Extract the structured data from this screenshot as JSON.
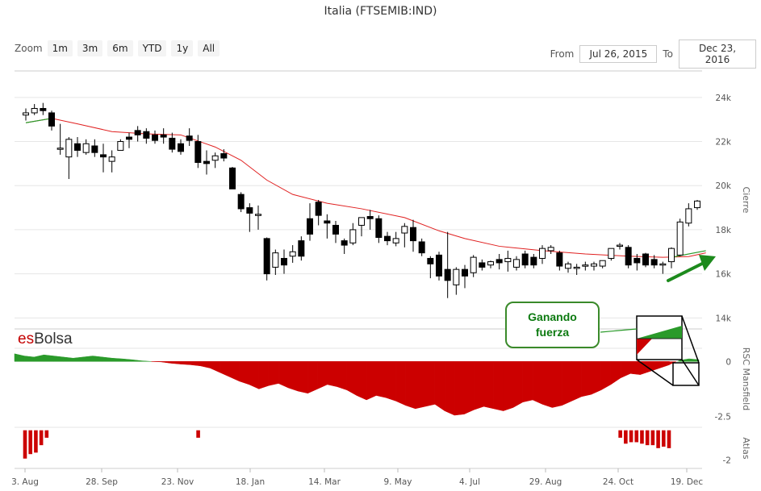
{
  "title": "Italia (FTSEMIB:IND)",
  "zoom": {
    "label": "Zoom",
    "buttons": [
      "1m",
      "3m",
      "6m",
      "YTD",
      "1y",
      "All"
    ]
  },
  "range": {
    "from_label": "From",
    "from_value": "Jul 26, 2015",
    "to_label": "To",
    "to_value": "Dec 23, 2016"
  },
  "brand": {
    "es": "es",
    "name": "Bolsa"
  },
  "callout": {
    "line1": "Ganando",
    "line2": "fuerza"
  },
  "colors": {
    "up_fill": "#ffffff",
    "down_fill": "#000000",
    "ma_line": "#e02020",
    "positive": "#2a9a2a",
    "negative": "#cc0000",
    "arrow": "#1c8a1c",
    "grid": "#e6e6e6"
  },
  "chart_data": [
    {
      "type": "candlestick",
      "title": "Italia (FTSEMIB:IND)",
      "ylabel": "Cierre",
      "ylim": [
        13500,
        25200
      ],
      "yticks": [
        14000,
        16000,
        18000,
        20000,
        22000,
        24000
      ],
      "ytick_labels": [
        "14k",
        "16k",
        "18k",
        "20k",
        "22k",
        "24k"
      ],
      "xticks": [
        "3. Aug",
        "28. Sep",
        "23. Nov",
        "18. Jan",
        "14. Mar",
        "9. May",
        "4. Jul",
        "29. Aug",
        "24. Oct",
        "19. Dec"
      ],
      "candles": [
        [
          23200,
          23500,
          22950,
          23300
        ],
        [
          23300,
          23700,
          23200,
          23500
        ],
        [
          23500,
          23750,
          23200,
          23400
        ],
        [
          23300,
          23400,
          22500,
          22700
        ],
        [
          21700,
          22800,
          21400,
          21700
        ],
        [
          21300,
          22200,
          20300,
          22100
        ],
        [
          21900,
          22200,
          21300,
          21600
        ],
        [
          21500,
          22100,
          21400,
          21900
        ],
        [
          21800,
          22100,
          21300,
          21500
        ],
        [
          21400,
          21900,
          20600,
          21300
        ],
        [
          21100,
          21600,
          20600,
          21300
        ],
        [
          21600,
          22100,
          21600,
          22000
        ],
        [
          22200,
          22400,
          21700,
          22100
        ],
        [
          22500,
          22700,
          22000,
          22300
        ],
        [
          22450,
          22600,
          21900,
          22150
        ],
        [
          22300,
          22500,
          21900,
          22050
        ],
        [
          22300,
          22600,
          21900,
          22200
        ],
        [
          22150,
          22400,
          21500,
          21650
        ],
        [
          21900,
          22100,
          21400,
          21550
        ],
        [
          22250,
          22600,
          21800,
          22050
        ],
        [
          22000,
          22300,
          20800,
          21050
        ],
        [
          21100,
          21600,
          20500,
          21000
        ],
        [
          21150,
          21500,
          20800,
          21350
        ],
        [
          21450,
          21650,
          21100,
          21250
        ],
        [
          20800,
          20850,
          19850,
          19850
        ],
        [
          19600,
          19700,
          18800,
          18950
        ],
        [
          19000,
          19200,
          17900,
          18750
        ],
        [
          18650,
          19100,
          18000,
          18700
        ],
        [
          17600,
          17650,
          15700,
          16000
        ],
        [
          16300,
          17100,
          15950,
          16950
        ],
        [
          16700,
          17100,
          16000,
          16400
        ],
        [
          16800,
          17300,
          16500,
          17000
        ],
        [
          17500,
          17700,
          16600,
          16800
        ],
        [
          18500,
          19200,
          17500,
          17800
        ],
        [
          19250,
          19350,
          18200,
          18650
        ],
        [
          18400,
          18700,
          17600,
          18300
        ],
        [
          18200,
          18400,
          17400,
          17800
        ],
        [
          17500,
          17600,
          16900,
          17300
        ],
        [
          17400,
          18300,
          17300,
          18000
        ],
        [
          18200,
          18500,
          17700,
          18550
        ],
        [
          18600,
          18900,
          18000,
          18500
        ],
        [
          18500,
          18650,
          17400,
          17650
        ],
        [
          17700,
          17900,
          17300,
          17500
        ],
        [
          17400,
          17900,
          17250,
          17600
        ],
        [
          17850,
          18300,
          17200,
          18150
        ],
        [
          18100,
          18450,
          17000,
          17500
        ],
        [
          17450,
          17600,
          16800,
          16950
        ],
        [
          16700,
          16800,
          15800,
          16450
        ],
        [
          16850,
          17000,
          15700,
          15900
        ],
        [
          16200,
          17900,
          14900,
          15700
        ],
        [
          15500,
          16300,
          15050,
          16200
        ],
        [
          16200,
          16400,
          15350,
          15900
        ],
        [
          16050,
          16850,
          15850,
          16750
        ],
        [
          16500,
          16650,
          16150,
          16300
        ],
        [
          16400,
          16600,
          16250,
          16550
        ],
        [
          16650,
          16900,
          16200,
          16500
        ],
        [
          16550,
          17050,
          16100,
          16700
        ],
        [
          16300,
          16800,
          16150,
          16650
        ],
        [
          16900,
          17050,
          16250,
          16400
        ],
        [
          16750,
          16900,
          16250,
          16400
        ],
        [
          16700,
          17300,
          16450,
          17150
        ],
        [
          17050,
          17300,
          16900,
          17200
        ],
        [
          16950,
          17050,
          16150,
          16350
        ],
        [
          16250,
          16550,
          16050,
          16450
        ],
        [
          16250,
          16450,
          15950,
          16300
        ],
        [
          16350,
          16550,
          16150,
          16400
        ],
        [
          16350,
          16550,
          16150,
          16450
        ],
        [
          16350,
          16600,
          16250,
          16600
        ],
        [
          16700,
          17150,
          16600,
          17150
        ],
        [
          17250,
          17400,
          17100,
          17300
        ],
        [
          17200,
          17300,
          16250,
          16400
        ],
        [
          16700,
          16900,
          16150,
          16500
        ],
        [
          16900,
          16950,
          16300,
          16400
        ],
        [
          16650,
          16850,
          16250,
          16400
        ],
        [
          16400,
          16550,
          16000,
          16450
        ],
        [
          16550,
          17200,
          16250,
          17150
        ],
        [
          16850,
          18500,
          16800,
          18350
        ],
        [
          18300,
          19200,
          18150,
          18950
        ],
        [
          19000,
          19350,
          18900,
          19300
        ]
      ],
      "moving_average": [
        [
          0,
          22850
        ],
        [
          3,
          23050
        ],
        [
          6,
          22800
        ],
        [
          10,
          22450
        ],
        [
          14,
          22350
        ],
        [
          18,
          22300
        ],
        [
          22,
          21750
        ],
        [
          25,
          21150
        ],
        [
          28,
          20250
        ],
        [
          31,
          19600
        ],
        [
          35,
          19200
        ],
        [
          39,
          18950
        ],
        [
          44,
          18550
        ],
        [
          48,
          17950
        ],
        [
          51,
          17600
        ],
        [
          55,
          17250
        ],
        [
          60,
          17050
        ],
        [
          65,
          16900
        ],
        [
          70,
          16800
        ],
        [
          74,
          16750
        ],
        [
          77,
          16780
        ],
        [
          79,
          16950
        ]
      ],
      "trend_line_start": [
        [
          0,
          22850
        ],
        [
          3,
          23050
        ]
      ],
      "trend_line_end": [
        [
          75,
          16750
        ],
        [
          79,
          17050
        ]
      ]
    },
    {
      "type": "area",
      "ylabel": "RSC Mansfield",
      "ylim": [
        -3.0,
        0.6
      ],
      "yticks": [
        0,
        -2.5
      ],
      "ytick_labels": [
        "0",
        "-2.5"
      ],
      "series": [
        {
          "values": [
            0.35,
            0.25,
            0.2,
            0.3,
            0.25,
            0.2,
            0.15,
            0.2,
            0.25,
            0.2,
            0.15,
            0.12,
            0.08,
            0.03,
            0.0,
            -0.02,
            -0.08,
            -0.12,
            -0.15,
            -0.2,
            -0.3,
            -0.5,
            -0.7,
            -0.9,
            -1.05,
            -1.25,
            -1.1,
            -1.0,
            -1.2,
            -1.35,
            -1.45,
            -1.25,
            -1.05,
            -1.15,
            -1.3,
            -1.55,
            -1.75,
            -1.55,
            -1.65,
            -1.8,
            -2.0,
            -2.15,
            -2.05,
            -1.95,
            -2.25,
            -2.45,
            -2.4,
            -2.2,
            -2.05,
            -2.15,
            -2.25,
            -2.1,
            -1.85,
            -1.75,
            -1.95,
            -2.1,
            -2.0,
            -1.8,
            -1.6,
            -1.5,
            -1.3,
            -1.05,
            -0.75,
            -0.55,
            -0.6,
            -0.45,
            -0.3,
            -0.15,
            0.05,
            0.12,
            0.08
          ]
        }
      ]
    },
    {
      "type": "bar",
      "ylabel": "Atlas",
      "ylim": [
        -2.4,
        0.2
      ],
      "yticks": [
        -2
      ],
      "ytick_labels": [
        "-2"
      ],
      "values": [
        -1.9,
        -1.6,
        -1.5,
        -1.0,
        -0.5,
        0,
        0,
        0,
        0,
        0,
        0,
        0,
        0,
        0,
        0,
        0,
        0,
        0,
        0,
        0,
        0,
        0,
        0,
        0,
        0,
        0,
        0,
        0,
        0,
        0,
        0,
        0,
        -0.5,
        0,
        0,
        0,
        0,
        0,
        0,
        0,
        0,
        0,
        0,
        0,
        0,
        0,
        0,
        0,
        0,
        0,
        0,
        0,
        0,
        0,
        0,
        0,
        0,
        0,
        0,
        0,
        0,
        0,
        0,
        0,
        0,
        0,
        0,
        0,
        0,
        0,
        0,
        0,
        0,
        0,
        0,
        0,
        0,
        0,
        0,
        0,
        0,
        0,
        0,
        0,
        0,
        0,
        0,
        0,
        0,
        0,
        0,
        0,
        0,
        0,
        0,
        0,
        0,
        0,
        0,
        0,
        0,
        0,
        0,
        0,
        0,
        0,
        0,
        0,
        0,
        0,
        -0.5,
        -0.9,
        -0.8,
        -0.8,
        -0.9,
        -1.0,
        -1.0,
        -1.2,
        -1.1,
        -1.2
      ]
    }
  ]
}
